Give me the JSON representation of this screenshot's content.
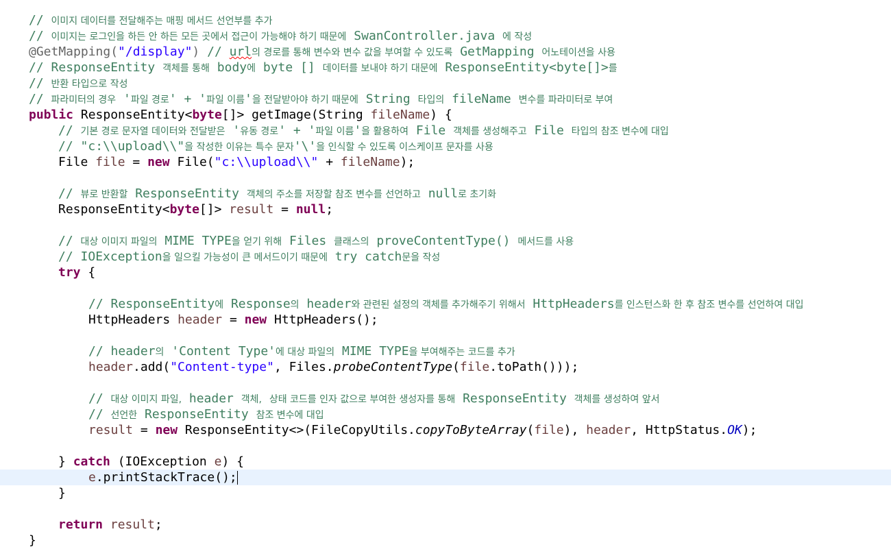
{
  "code": {
    "l01_ko": "이미지 데이터를 전달해주는 매핑 메서드 선언부를 추가",
    "l02_ko_a": "이미지는 로그인을 하든 안 하든 모든 곳에서 접근이 가능해야 하기 때문에",
    "l02_cls": "SwanController.java",
    "l02_ko_b": "에 작성",
    "l03_ann": "@GetMapping(",
    "l03_str": "\"/display\"",
    "l03_close": ")",
    "l03_url": "url",
    "l03_ko_a": "의 경로를 통해 변수와 변수 값을 부여할 수 있도록",
    "l03_gm": "GetMapping",
    "l03_ko_b": "어노테이션을 사용",
    "l04_re": "ResponseEntity",
    "l04_ko_a": "객체를 통해",
    "l04_body": "body",
    "l04_ko_b": "에",
    "l04_byte": "byte []",
    "l04_ko_c": "데이터를 보내야 하기 대문에",
    "l04_reb": "ResponseEntity<byte[]>",
    "l04_ko_d": "를",
    "l05_ko": "반환 타입으로 작성",
    "l06_ko_a": "파라미터의 경우",
    "l06_q1": "'",
    "l06_ko_b": "파일 경로",
    "l06_q2": "' + '",
    "l06_ko_c": "파일 이름",
    "l06_q3": "'",
    "l06_ko_d": "을 전달받아야 하기 때문에",
    "l06_string": "String",
    "l06_ko_e": "타입의",
    "l06_fn": "fileName",
    "l06_ko_f": "변수를 파라미터로 부여",
    "l07_public": "public",
    "l07_re": "ResponseEntity<",
    "l07_byte": "byte",
    "l07_rest": "[]> getImage(String",
    "l07_fn": "fileName",
    "l07_end": ") {",
    "l08_ko_a": "기본 경로 문자열 데이터와 전달받은",
    "l08_q1": "'",
    "l08_ko_b": "유동 경로",
    "l08_q2": "' + '",
    "l08_ko_c": "파일 이름",
    "l08_q3": "'",
    "l08_ko_d": "을 활용하여",
    "l08_file": "File",
    "l08_ko_e": "객체를 생성해주고",
    "l08_file2": "File",
    "l08_ko_f": "타입의 참조 변수에 대입",
    "l09_path": "\"c:\\\\upload\\\\\"",
    "l09_ko_a": "을 작성한 이유는 특수 문자",
    "l09_bs": "'\\'",
    "l09_ko_b": "을 인식할 수 있도록 이스케이프 문자를 사용",
    "l10_file": "File",
    "l10_var": "file",
    "l10_eq": "=",
    "l10_new": "new",
    "l10_ctor": "File(",
    "l10_str": "\"c:\\\\upload\\\\\"",
    "l10_plus": "+",
    "l10_fn": "fileName",
    "l10_end": ");",
    "l12_ko_a": "뷰로 반환할",
    "l12_re": "ResponseEntity",
    "l12_ko_b": "객체의 주소를 저장할 참조 변수를 선언하고",
    "l12_null": "null",
    "l12_ko_c": "로 초기화",
    "l13_re": "ResponseEntity<",
    "l13_byte": "byte",
    "l13_close": "[]>",
    "l13_var": "result",
    "l13_eq": "=",
    "l13_null": "null",
    "l13_end": ";",
    "l15_ko_a": "대상 이미지 파일의",
    "l15_mime": "MIME TYPE",
    "l15_ko_b": "을 얻기 위해",
    "l15_files": "Files",
    "l15_ko_c": "클래스의",
    "l15_pct": "proveContentType()",
    "l15_ko_d": "메서드를 사용",
    "l16_ioe": "IOException",
    "l16_ko_a": "을 일으킬 가능성이 큰 메서드이기 때문에",
    "l16_tc": "try catch",
    "l16_ko_b": "문을 작성",
    "l17_try": "try",
    "l17_brace": "{",
    "l19_re": "ResponseEntity",
    "l19_ko_a": "에",
    "l19_resp": "Response",
    "l19_ko_b": "의",
    "l19_header": "header",
    "l19_ko_c": "와 관련된 설정의 객체를 추가해주기 위해서",
    "l19_hh": "HttpHeaders",
    "l19_ko_d": "를 인스턴스화 한 후 참조 변수를 선언하여 대입",
    "l20_type": "HttpHeaders",
    "l20_var": "header",
    "l20_eq": "=",
    "l20_new": "new",
    "l20_ctor": "HttpHeaders();",
    "l22_header": "header",
    "l22_ko_a": "의",
    "l22_ct": "'Content Type'",
    "l22_ko_b": "에 대상 파일의",
    "l22_mime": "MIME TYPE",
    "l22_ko_c": "을 부여해주는 코드를 추가",
    "l23_var": "header",
    "l23_add": ".add(",
    "l23_str": "\"Content-type\"",
    "l23_files": ", Files.",
    "l23_pct": "probeContentType",
    "l23_open": "(",
    "l23_file": "file",
    "l23_end": ".toPath()));",
    "l25_ko_a": "대상 이미지 파일,",
    "l25_header": "header",
    "l25_ko_b": "객체,",
    "l25_ko_c": "상태 코드를 인자 값으로 부여한 생성자를 통해",
    "l25_re": "ResponseEntity",
    "l25_ko_d": "객체를 생성하여 앞서",
    "l26_ko_a": "선언한",
    "l26_re": "ResponseEntity",
    "l26_ko_b": "참조 변수에 대입",
    "l27_var": "result",
    "l27_eq": "=",
    "l27_new": "new",
    "l27_ctor": "ResponseEntity<>(FileCopyUtils.",
    "l27_ctba": "copyToByteArray",
    "l27_open": "(",
    "l27_file": "file",
    "l27_sep1": "),",
    "l27_header": "header",
    "l27_sep2": ", HttpStatus.",
    "l27_ok": "OK",
    "l27_end": ");",
    "l29_close": "}",
    "l29_catch": "catch",
    "l29_open": "(IOException",
    "l29_e": "e",
    "l29_end": ") {",
    "l30_e": "e",
    "l30_call": ".printStackTrace();",
    "l31_close": "}",
    "l33_return": "return",
    "l33_var": "result",
    "l33_end": ";",
    "l34_close": "}"
  }
}
